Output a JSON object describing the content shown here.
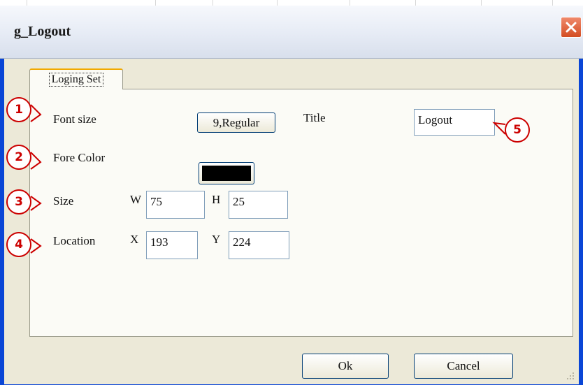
{
  "window": {
    "title": "g_Logout"
  },
  "tabs": [
    {
      "label": "Loging Set"
    }
  ],
  "form": {
    "font_size_label": "Font size",
    "font_size_value": "9,Regular",
    "title_label": "Title",
    "title_value": "Logout",
    "fore_color_label": "Fore Color",
    "fore_color_value": "#000000",
    "size_label": "Size",
    "w_label": "W",
    "w_value": "75",
    "h_label": "H",
    "h_value": "25",
    "location_label": "Location",
    "x_label": "X",
    "x_value": "193",
    "y_label": "Y",
    "y_value": "224"
  },
  "callouts": [
    "1",
    "2",
    "3",
    "4",
    "5"
  ],
  "buttons": {
    "ok": "Ok",
    "cancel": "Cancel"
  },
  "colors": {
    "callout": "#cc0000",
    "tab_highlight": "#f2a900",
    "close_button": "#d34d22",
    "window_frame": "#0a46d6"
  },
  "icons": {
    "close": "close-icon",
    "resize": "resize-grip-icon"
  }
}
